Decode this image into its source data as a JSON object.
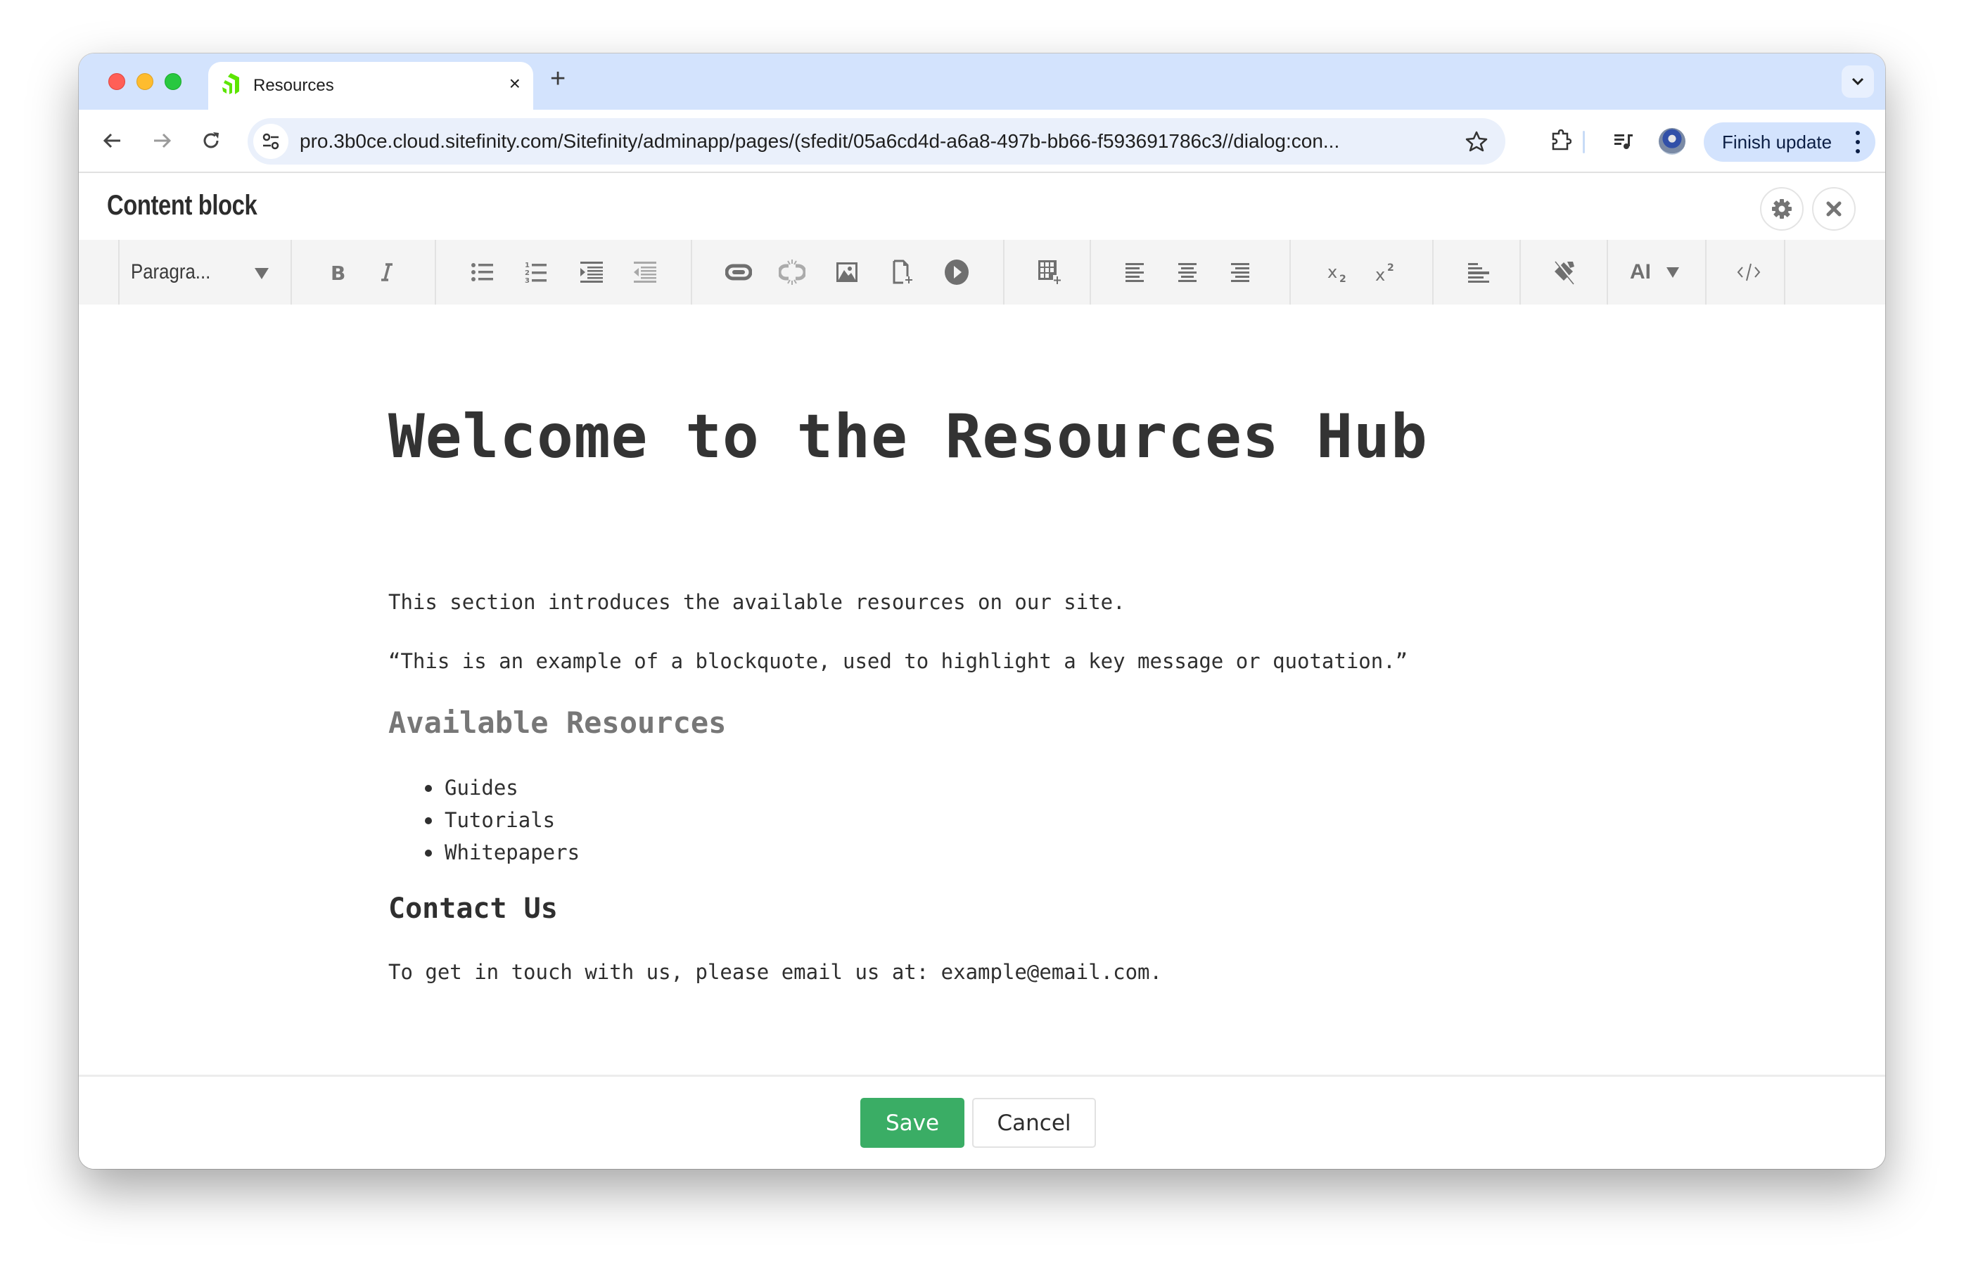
{
  "browser": {
    "tab": {
      "title": "Resources",
      "close_glyph": "×",
      "favicon": "sitefinity-logo-icon"
    },
    "new_tab_glyph": "+",
    "url": "pro.3b0ce.cloud.sitefinity.com/Sitefinity/adminapp/pages/(sfedit/05a6cd4d-a6a8-497b-bb66-f593691786c3//dialog:con...",
    "finish_update_label": "Finish update",
    "colors": {
      "tabstrip": "#d3e3fd",
      "omnibox": "#eaf0fb",
      "favicon_green": "#5ce500"
    }
  },
  "dialog": {
    "title": "Content block",
    "toolbar": {
      "format_select": {
        "value": "Paragra..."
      },
      "ai_label": "AI",
      "buttons": [
        "bold",
        "italic",
        "bulleted-list",
        "numbered-list",
        "indent",
        "outdent",
        "insert-link",
        "unlink",
        "insert-image",
        "insert-document",
        "insert-video",
        "insert-table",
        "align-left",
        "align-center",
        "align-right",
        "subscript",
        "superscript",
        "format-block",
        "clear-formatting",
        "ai-assistant",
        "view-html"
      ]
    },
    "content": {
      "heading1": "Welcome to the Resources Hub",
      "intro": "This section introduces the available resources on our site.",
      "blockquote": "“This is an example of a blockquote, used to highlight a key message or quotation.”",
      "heading2": "Available Resources",
      "list": [
        "Guides",
        "Tutorials",
        "Whitepapers"
      ],
      "heading3": "Contact Us",
      "contact": "To get in touch with us, please email us at: example@email.com."
    },
    "footer": {
      "save_label": "Save",
      "cancel_label": "Cancel",
      "save_color": "#3aad65"
    }
  }
}
